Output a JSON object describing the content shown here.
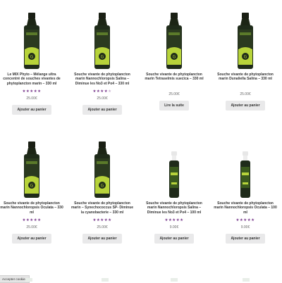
{
  "products": [
    {
      "title": "Le MIX Phyto – Mélange ultra concentré de souches vivantes de phytoplancton marin – 330 ml",
      "rating": 5,
      "price": "25.00€",
      "button": "Ajouter au panier",
      "image": "large-bottle"
    },
    {
      "title": "Souche vivante de phytoplancton marin Nannochloropsis Salina – Diminue les No3 et Po4 – 330 ml",
      "rating": 4,
      "price": "25.00€",
      "button": "Ajouter au panier",
      "image": "large-bottle"
    },
    {
      "title": "Souche vivante de phytoplancton marin Tetraselmis suecica – 330 ml",
      "rating": 0,
      "price": "25.00€",
      "button": "Lire la suite",
      "image": "large-bottle"
    },
    {
      "title": "Souche vivante de phytoplancton marin Dunaliella Salina – 330 ml",
      "rating": 0,
      "price": "25.00€",
      "button": "Ajouter au panier",
      "image": "large-bottle"
    },
    {
      "title": "Souche vivante de phytoplancton marin Nannochloropsis Oculata – 330 ml",
      "rating": 5,
      "price": "25.00€",
      "button": "Ajouter au panier",
      "image": "large-bottle"
    },
    {
      "title": "Souche vivante de phytoplancton marin – Synechococcus SP- Diminue la cyanobacterie – 330 ml",
      "rating": 4.5,
      "price": "25.00€",
      "button": "Ajouter au panier",
      "image": "large-bottle"
    },
    {
      "title": "Souche vivante de phytoplancton marin Nannochloropsis Salina – Diminue les No3 et Po4 – 100 ml",
      "rating": 5,
      "price": "9.00€",
      "button": "Ajouter au panier",
      "image": "small-bottle"
    },
    {
      "title": "Souche vivante de phytoplancton marin Nannochloropsis Oculata – 100 ml",
      "rating": 5,
      "price": "9.00€",
      "button": "Ajouter au panier",
      "image": "small-bottle"
    }
  ],
  "cookie_tab": {
    "label": "Accepter cookies"
  },
  "colors": {
    "star": "#7b3d8e",
    "bottle": "#1f2b1a",
    "label_green": "#b7d33a",
    "button_bg": "#e9e9ea"
  }
}
